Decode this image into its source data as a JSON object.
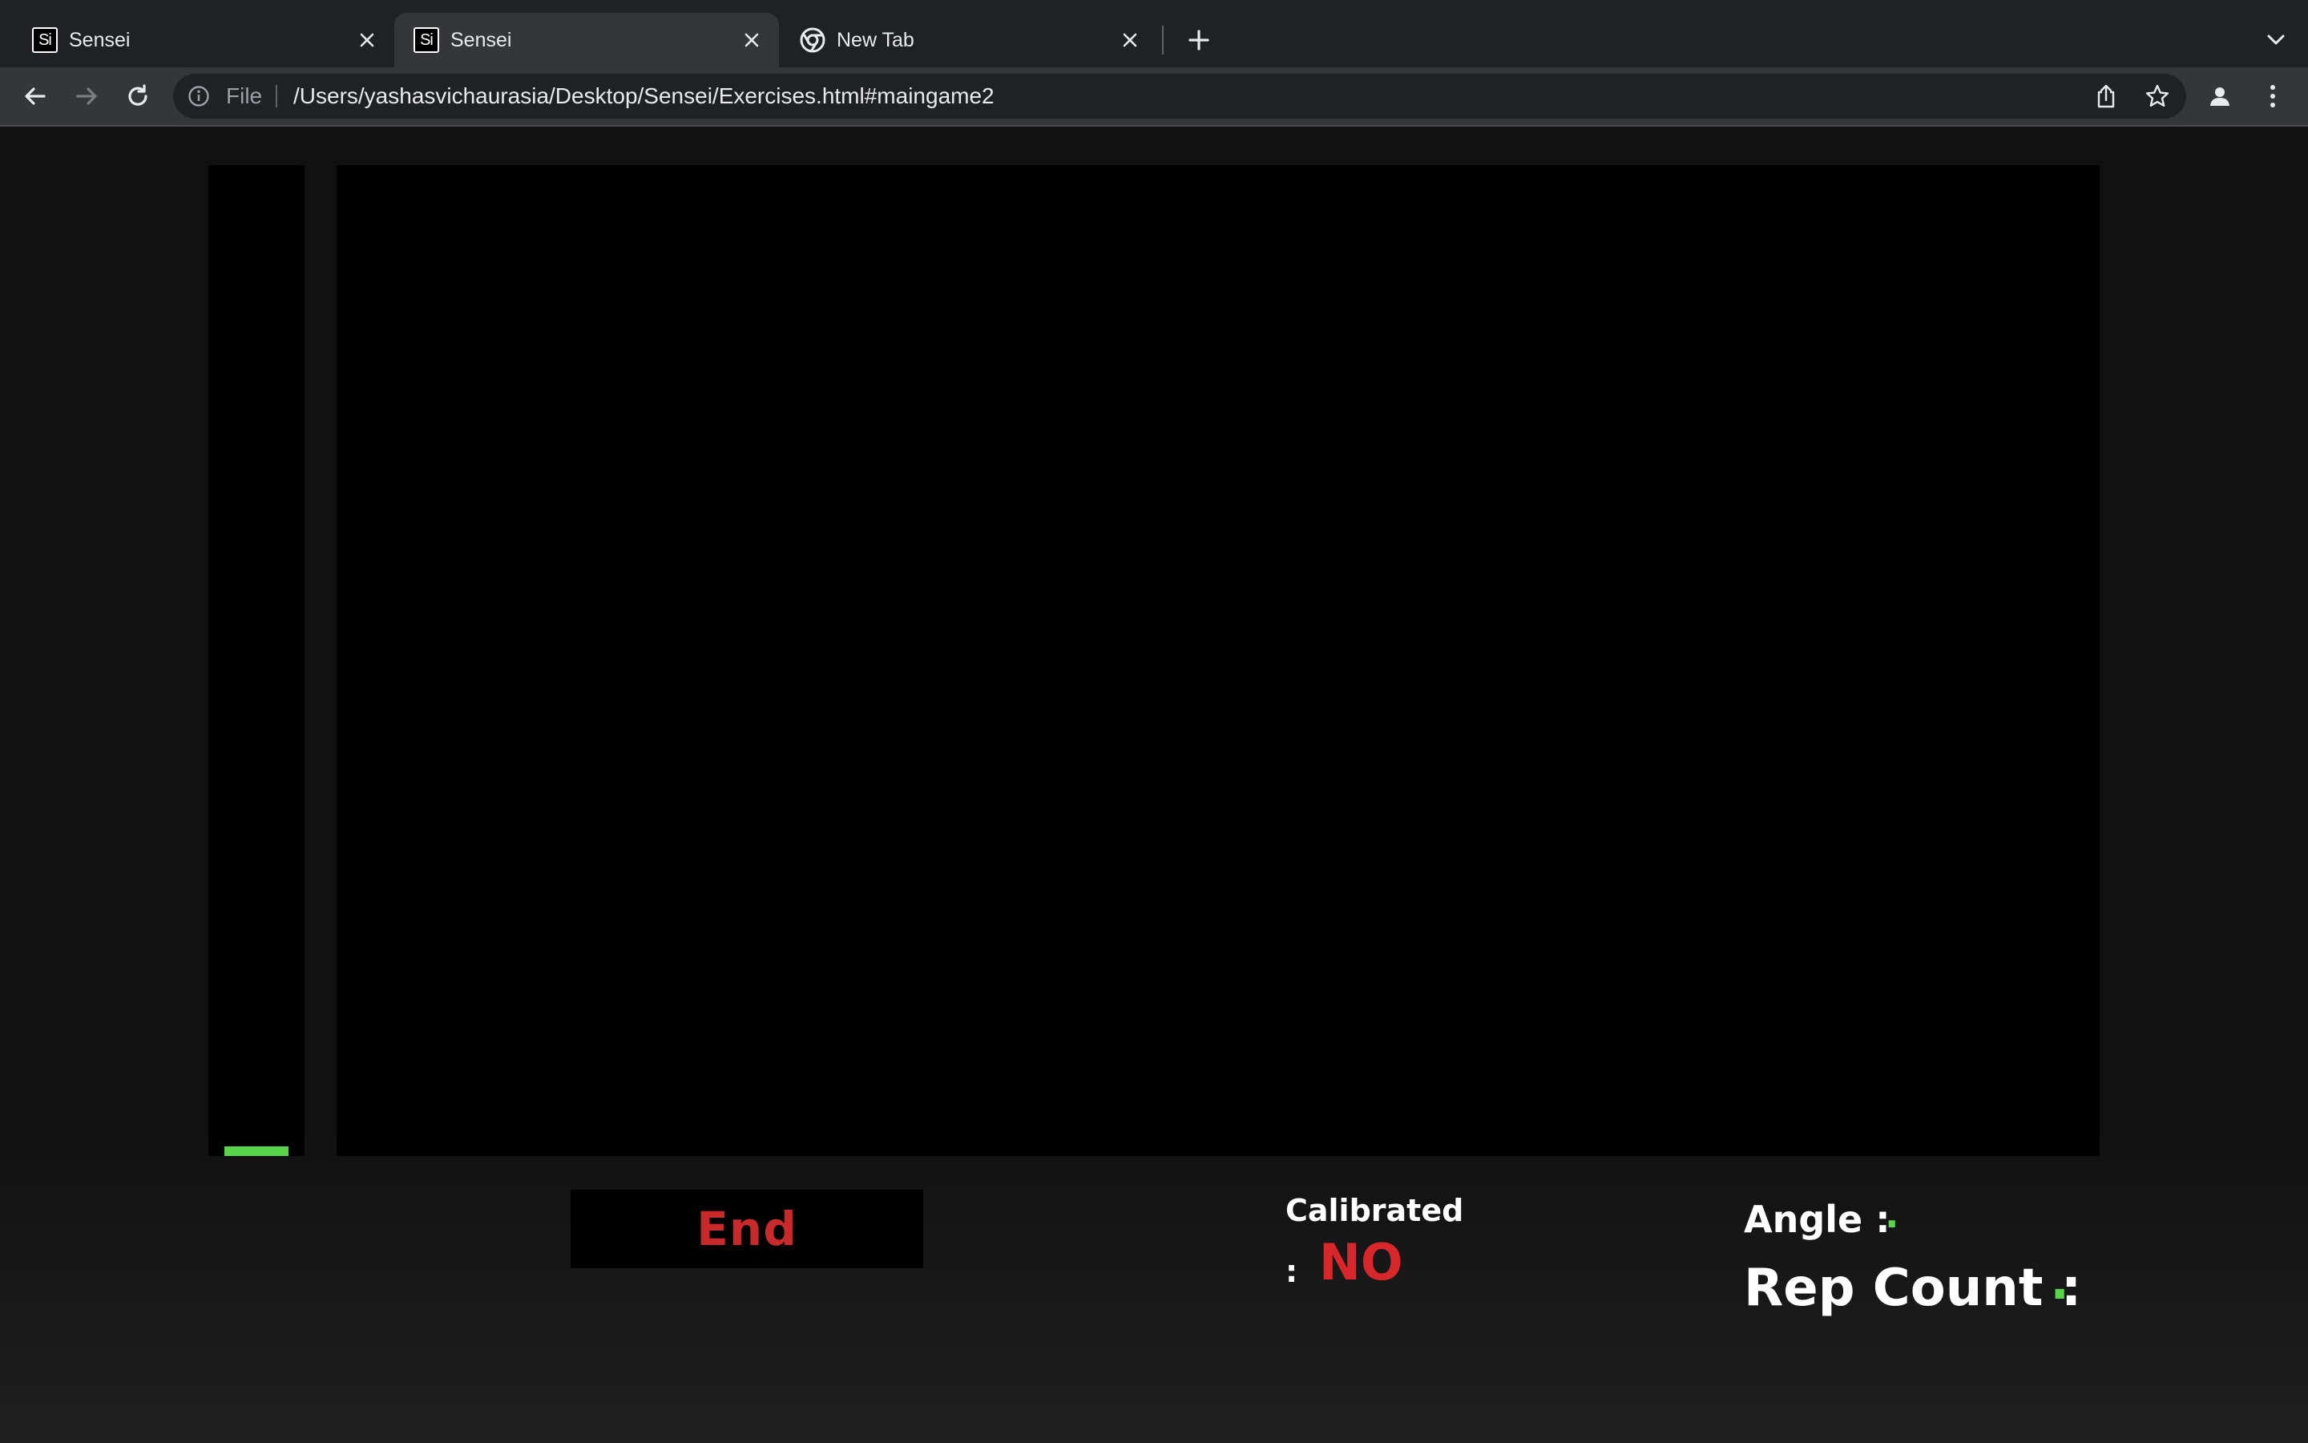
{
  "browser": {
    "tabs": [
      {
        "title": "Sensei",
        "favicon": "Si",
        "active": false
      },
      {
        "title": "Sensei",
        "favicon": "Si",
        "active": true
      },
      {
        "title": "New Tab",
        "favicon": "chrome-icon",
        "active": false
      }
    ],
    "omnibox": {
      "scheme": "File",
      "url": "/Users/yashasvichaurasia/Desktop/Sensei/Exercises.html#maingame2"
    }
  },
  "game": {
    "meter_level_percent": 1,
    "end_label": "End",
    "calibrated_label": "Calibrated",
    "calibrated_colon": ":",
    "calibrated_value": "NO",
    "angle_label": "Angle :",
    "angle_value": ".",
    "rep_count_label": "Rep Count :",
    "rep_count_value": "."
  },
  "colors": {
    "accent_green": "#58d34a",
    "alert_red": "#d8272a",
    "end_red": "#c8292b",
    "page_bg": "#111112"
  }
}
